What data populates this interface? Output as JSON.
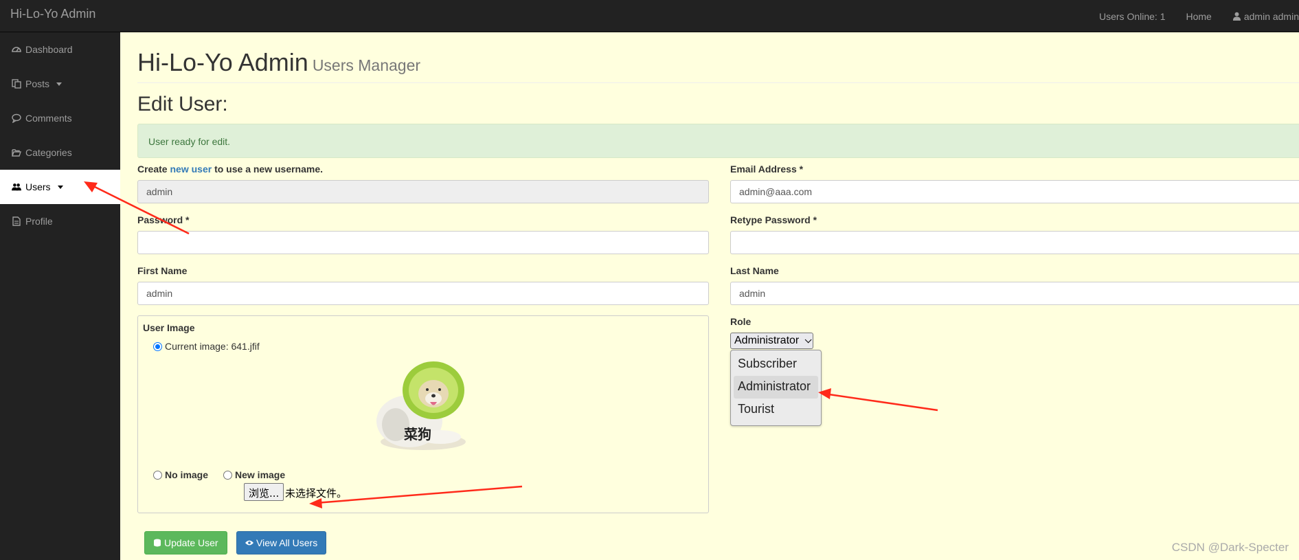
{
  "topbar": {
    "brand": "Hi-Lo-Yo Admin",
    "users_online": "Users Online: 1",
    "home": "Home",
    "user": "admin admin",
    "user_icon": "user-icon"
  },
  "sidebar": {
    "items": [
      {
        "label": "Dashboard",
        "icon": "dashboard-icon"
      },
      {
        "label": "Posts",
        "icon": "files-icon"
      },
      {
        "label": "Comments",
        "icon": "comment-icon"
      },
      {
        "label": "Categories",
        "icon": "folder-open-icon"
      },
      {
        "label": "Users",
        "icon": "users-icon"
      },
      {
        "label": "Profile",
        "icon": "file-text-icon"
      }
    ],
    "active": "Users"
  },
  "header": {
    "title": "Hi-Lo-Yo Admin",
    "subtitle": "Users Manager"
  },
  "form": {
    "heading": "Edit User:",
    "alert": "User ready for edit.",
    "username_label_pre": "Create",
    "username_label_link": "new user",
    "username_label_post": "to use a new username.",
    "username_value": "admin",
    "email_label": "Email Address *",
    "email_value": "admin@aaa.com",
    "password_label": "Password *",
    "retype_label": "Retype Password *",
    "first_name_label": "First Name",
    "first_name_value": "admin",
    "last_name_label": "Last Name",
    "last_name_value": "admin",
    "image": {
      "label": "User Image",
      "current": "Current image: 641.jfif",
      "caption": "菜狗",
      "no_image": "No image",
      "new_image": "New image",
      "browse": "浏览...",
      "no_file": "未选择文件。"
    },
    "role": {
      "label": "Role",
      "selected": "Administrator",
      "options": [
        "Subscriber",
        "Administrator",
        "Tourist"
      ]
    },
    "update_button": "Update User",
    "view_all_button": "View All Users"
  },
  "watermark": "CSDN @Dark-Specter",
  "colors": {
    "page_bg": "#ffffde",
    "nav_bg": "#222222",
    "alert_bg": "#dff0d8",
    "success": "#5cb85c",
    "primary": "#337ab7",
    "annotation": "#ff2a1a"
  }
}
